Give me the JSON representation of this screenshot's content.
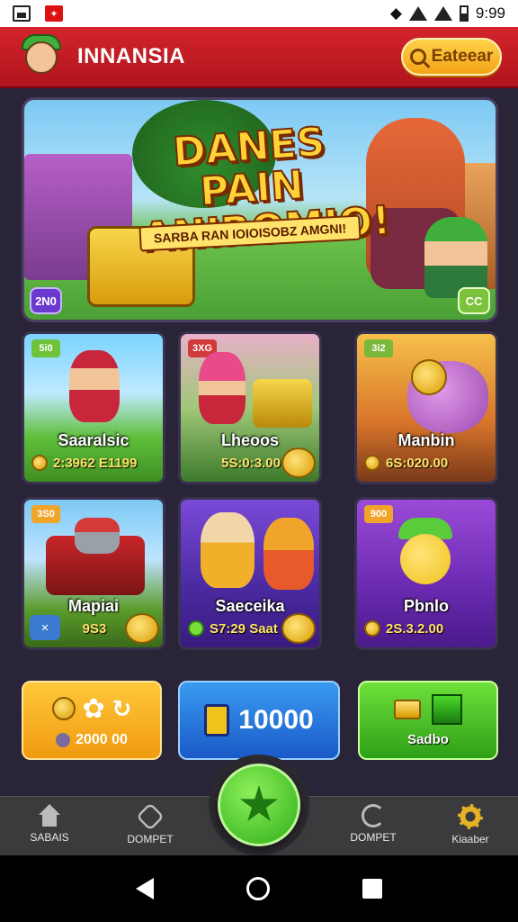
{
  "status_bar": {
    "time": "9:99"
  },
  "app_bar": {
    "title": "INNANSIA",
    "login_label": "Eateear"
  },
  "banner": {
    "title_line1": "DANES PAIN",
    "title_line2": "ANIROMIO!",
    "subtitle": "SARBA RAN IOIOISOBZ AMGNI!",
    "badge_left": "2N0",
    "badge_right": "CC"
  },
  "cards": [
    {
      "tag": "5i0",
      "title": "Saaralsic",
      "value": "2:3962 E1199",
      "color": "#4caf32"
    },
    {
      "tag": "3XG",
      "title": "Lheoos",
      "value": "5S:0:3.00",
      "color": "#2f7a2a"
    },
    {
      "tag": "3i2",
      "title": "Manbin",
      "value": "6S:020.00",
      "color": "#c86a1a"
    },
    {
      "tag": "3S0",
      "title": "Mapiai",
      "value": "9S3",
      "color": "#3a8fd0"
    },
    {
      "tag": "",
      "title": "Saeceika",
      "value": "S7:29 Saat",
      "color": "#5a2ab0"
    },
    {
      "tag": "900",
      "title": "Pbnlo",
      "value": "2S.3.2.00",
      "color": "#6a2aa0"
    }
  ],
  "actions": {
    "left_value": "2000 00",
    "middle_value": "10000",
    "right_label": "Sadbo"
  },
  "bottom_nav": {
    "item1": "SABAIS",
    "item2": "DOMPET",
    "item3": "DOMPET",
    "item4": "Kiaaber"
  }
}
